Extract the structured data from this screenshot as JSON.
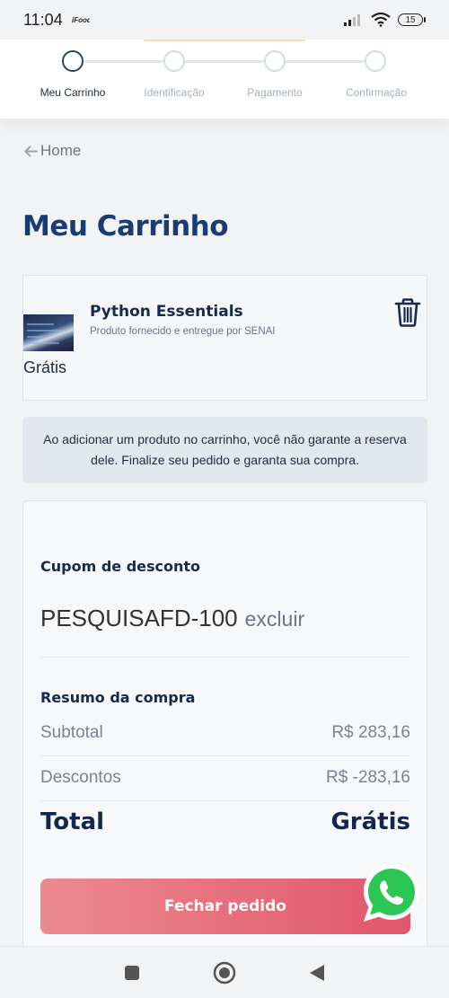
{
  "status_bar": {
    "time": "11:04",
    "battery": "15",
    "icons": [
      "ifood-icon",
      "signal-icon",
      "wifi-icon",
      "battery-icon"
    ]
  },
  "stepper": {
    "steps": [
      {
        "label": "Meu Carrinho",
        "active": true
      },
      {
        "label": "Identificação",
        "active": false
      },
      {
        "label": "Pagamento",
        "active": false
      },
      {
        "label": "Confirmação",
        "active": false
      }
    ]
  },
  "breadcrumb": {
    "label": "Home",
    "icon": "arrow-left-icon"
  },
  "page_title": "Meu Carrinho",
  "cart": {
    "item": {
      "name": "Python Essentials",
      "vendor": "Produto fornecido e entregue por SENAI",
      "price": "Grátis",
      "delete_icon": "trash-icon"
    },
    "notice": "Ao adicionar um produto no carrinho, você não garante a reserva dele. Finalize seu pedido e garanta sua compra."
  },
  "summary": {
    "coupon_title": "Cupom de desconto",
    "coupon_code": "PESQUISAFD-100",
    "coupon_remove": "excluir",
    "resume_title": "Resumo da compra",
    "subtotal_label": "Subtotal",
    "subtotal_value": "R$ 283,16",
    "discount_label": "Descontos",
    "discount_value": "R$ -283,16",
    "total_label": "Total",
    "total_value": "Grátis",
    "checkout_label": "Fechar pedido"
  },
  "colors": {
    "accent": "#1b3b73",
    "checkout_start": "#ec8a8f",
    "checkout_end": "#e1566b",
    "whatsapp": "#25d366"
  }
}
